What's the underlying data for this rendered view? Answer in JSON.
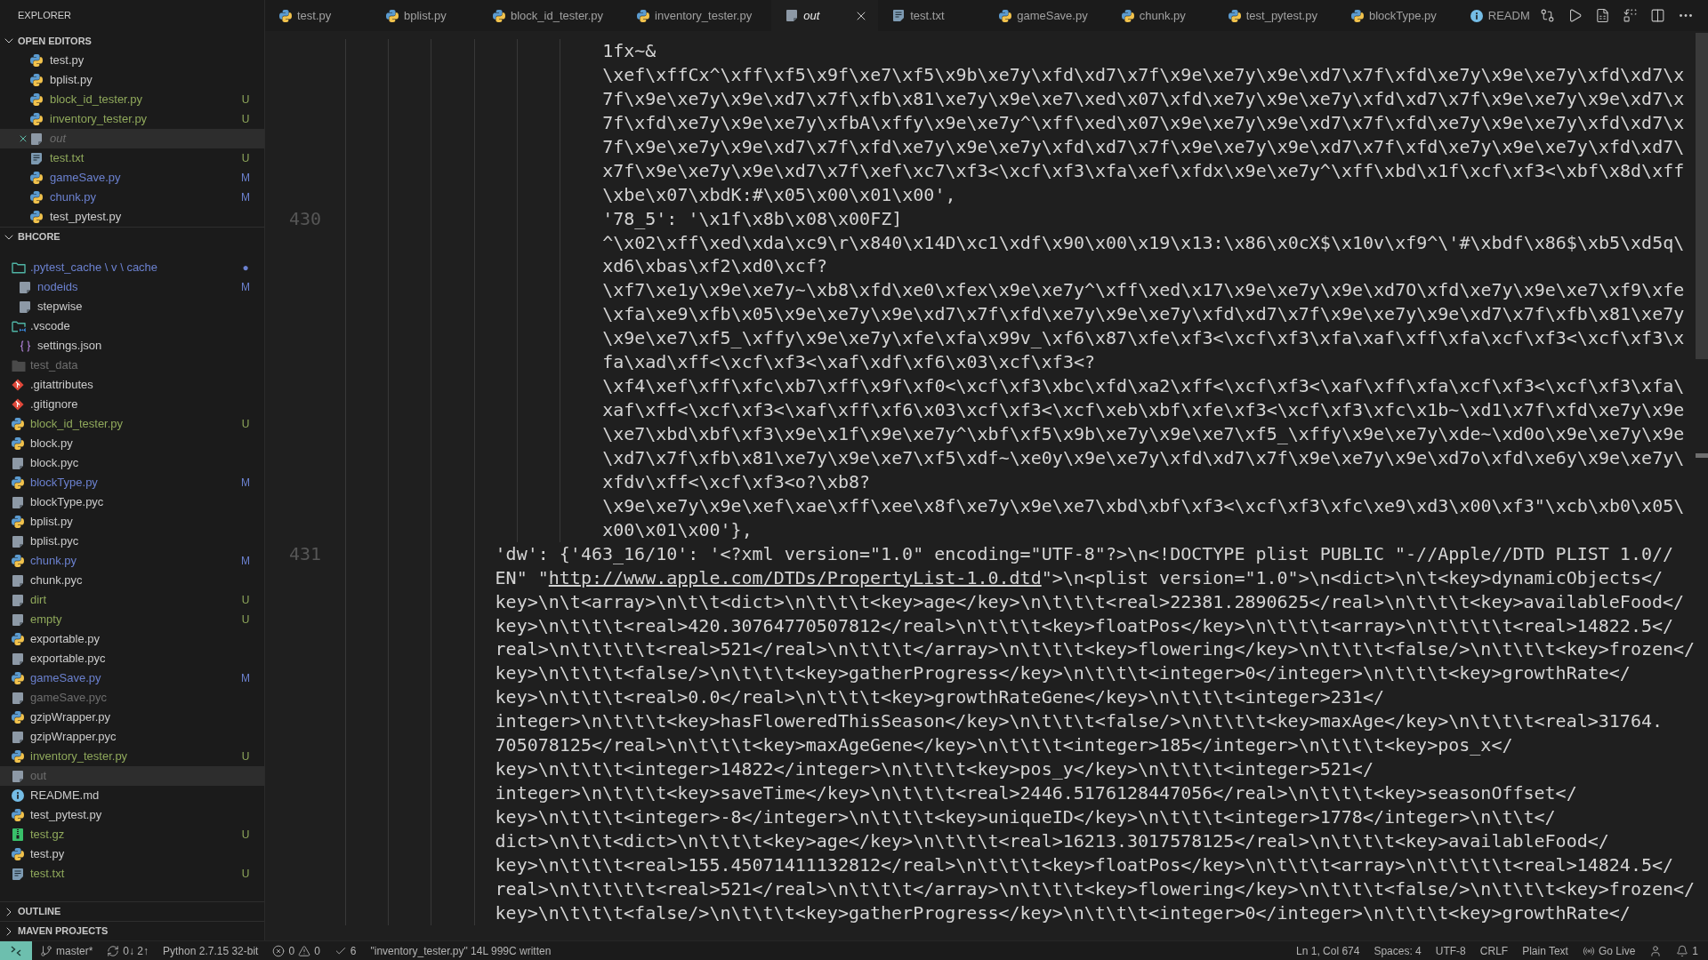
{
  "sidebar": {
    "title": "EXPLORER",
    "open_editors": {
      "title": "OPEN EDITORS",
      "expanded": true,
      "items": [
        {
          "name": "test.py",
          "kind": "python",
          "color": "#cccccc",
          "selected": false,
          "preview": false
        },
        {
          "name": "bplist.py",
          "kind": "python",
          "color": "#cccccc",
          "selected": false,
          "preview": false
        },
        {
          "name": "block_id_tester.py",
          "kind": "python",
          "color": "#8fa85b",
          "badge": "U",
          "selected": false,
          "preview": false
        },
        {
          "name": "inventory_tester.py",
          "kind": "python",
          "color": "#8fa85b",
          "badge": "U",
          "selected": false,
          "preview": false
        },
        {
          "name": "out",
          "kind": "file",
          "color": "#6e6e6e",
          "selected": true,
          "preview": true
        },
        {
          "name": "test.txt",
          "kind": "text",
          "color": "#8fa85b",
          "badge": "U",
          "selected": false,
          "preview": false
        },
        {
          "name": "gameSave.py",
          "kind": "python",
          "color": "#6b81cf",
          "badge": "M",
          "selected": false,
          "preview": false
        },
        {
          "name": "chunk.py",
          "kind": "python",
          "color": "#6b81cf",
          "badge": "M",
          "selected": false,
          "preview": false
        },
        {
          "name": "test_pytest.py",
          "kind": "python",
          "color": "#cccccc",
          "selected": false,
          "preview": false
        }
      ]
    },
    "folder": {
      "title": "BHCORE",
      "expanded": true,
      "items": [
        {
          "name": ".pytest_cache \\ v \\ cache",
          "kind": "folder",
          "expanded": true,
          "color": "#6b81cf",
          "badge": "●",
          "selected": false,
          "children": [
            {
              "name": "nodeids",
              "kind": "file",
              "color": "#6b81cf",
              "badge": "M",
              "selected": false
            },
            {
              "name": "stepwise",
              "kind": "file",
              "color": "#cccccc",
              "selected": false
            }
          ]
        },
        {
          "name": ".vscode",
          "kind": "vscode-folder",
          "expanded": true,
          "color": "#cccccc",
          "selected": false,
          "children": [
            {
              "name": "settings.json",
              "kind": "json",
              "color": "#cccccc",
              "selected": false
            }
          ]
        },
        {
          "name": "test_data",
          "kind": "folder",
          "expanded": false,
          "color": "#6e6e6e",
          "selected": false
        },
        {
          "name": ".gitattributes",
          "kind": "git",
          "color": "#cccccc",
          "selected": false
        },
        {
          "name": ".gitignore",
          "kind": "git",
          "color": "#cccccc",
          "selected": false
        },
        {
          "name": "block_id_tester.py",
          "kind": "python",
          "color": "#8fa85b",
          "badge": "U",
          "selected": false
        },
        {
          "name": "block.py",
          "kind": "python",
          "color": "#cccccc",
          "selected": false
        },
        {
          "name": "block.pyc",
          "kind": "file",
          "color": "#cccccc",
          "selected": false
        },
        {
          "name": "blockType.py",
          "kind": "python",
          "color": "#6b81cf",
          "badge": "M",
          "selected": false
        },
        {
          "name": "blockType.pyc",
          "kind": "file",
          "color": "#cccccc",
          "selected": false
        },
        {
          "name": "bplist.py",
          "kind": "python",
          "color": "#cccccc",
          "selected": false
        },
        {
          "name": "bplist.pyc",
          "kind": "file",
          "color": "#cccccc",
          "selected": false
        },
        {
          "name": "chunk.py",
          "kind": "python",
          "color": "#6b81cf",
          "badge": "M",
          "selected": false
        },
        {
          "name": "chunk.pyc",
          "kind": "file",
          "color": "#cccccc",
          "selected": false
        },
        {
          "name": "dirt",
          "kind": "file",
          "color": "#8fa85b",
          "badge": "U",
          "selected": false
        },
        {
          "name": "empty",
          "kind": "file",
          "color": "#8fa85b",
          "badge": "U",
          "selected": false
        },
        {
          "name": "exportable.py",
          "kind": "python",
          "color": "#cccccc",
          "selected": false
        },
        {
          "name": "exportable.pyc",
          "kind": "file",
          "color": "#cccccc",
          "selected": false
        },
        {
          "name": "gameSave.py",
          "kind": "python",
          "color": "#6b81cf",
          "badge": "M",
          "selected": false
        },
        {
          "name": "gameSave.pyc",
          "kind": "file",
          "color": "#6e6e6e",
          "selected": false
        },
        {
          "name": "gzipWrapper.py",
          "kind": "python",
          "color": "#cccccc",
          "selected": false
        },
        {
          "name": "gzipWrapper.pyc",
          "kind": "file",
          "color": "#cccccc",
          "selected": false
        },
        {
          "name": "inventory_tester.py",
          "kind": "python",
          "color": "#8fa85b",
          "badge": "U",
          "selected": false
        },
        {
          "name": "out",
          "kind": "file",
          "color": "#6e6e6e",
          "selected": true
        },
        {
          "name": "README.md",
          "kind": "info",
          "color": "#cccccc",
          "selected": false
        },
        {
          "name": "test_pytest.py",
          "kind": "python",
          "color": "#cccccc",
          "selected": false
        },
        {
          "name": "test.gz",
          "kind": "archive",
          "color": "#8fa85b",
          "badge": "U",
          "selected": false
        },
        {
          "name": "test.py",
          "kind": "python",
          "color": "#cccccc",
          "selected": false
        },
        {
          "name": "test.txt",
          "kind": "text",
          "color": "#8fa85b",
          "badge": "U",
          "selected": false
        }
      ]
    },
    "sections": [
      {
        "title": "OUTLINE",
        "expanded": false
      },
      {
        "title": "MAVEN PROJECTS",
        "expanded": false
      }
    ]
  },
  "tabs": [
    {
      "label": "test.py",
      "kind": "python",
      "selected": false,
      "preview": false
    },
    {
      "label": "bplist.py",
      "kind": "python",
      "selected": false,
      "preview": false
    },
    {
      "label": "block_id_tester.py",
      "kind": "python",
      "selected": false,
      "preview": false
    },
    {
      "label": "inventory_tester.py",
      "kind": "python",
      "selected": false,
      "preview": false
    },
    {
      "label": "out",
      "kind": "file",
      "selected": true,
      "preview": true
    },
    {
      "label": "test.txt",
      "kind": "text",
      "selected": false,
      "preview": false
    },
    {
      "label": "gameSave.py",
      "kind": "python",
      "selected": false,
      "preview": false
    },
    {
      "label": "chunk.py",
      "kind": "python",
      "selected": false,
      "preview": false
    },
    {
      "label": "test_pytest.py",
      "kind": "python",
      "selected": false,
      "preview": false
    },
    {
      "label": "blockType.py",
      "kind": "python",
      "selected": false,
      "preview": false
    },
    {
      "label": "READM",
      "kind": "info",
      "selected": false,
      "preview": false
    }
  ],
  "editor": {
    "lines": [
      {
        "rows": [
          {
            "text": "1fx~&"
          },
          {
            "text": "\\xef\\xffCx^\\xff\\xf5\\x9f\\xe7\\xf5\\x9b\\xe7y\\xfd\\xd7\\x7f\\x9e\\xe7y\\x9e\\xd7\\x7f\\xfd\\xe7y\\x9e\\xe7y\\xfd\\xd7\\x"
          },
          {
            "text": "7f\\x9e\\xe7y\\x9e\\xd7\\x7f\\xfb\\x81\\xe7y\\x9e\\xe7\\xed\\x07\\xfd\\xe7y\\x9e\\xe7y\\xfd\\xd7\\x7f\\x9e\\xe7y\\x9e\\xd7\\x"
          },
          {
            "text": "7f\\xfd\\xe7y\\x9e\\xe7y\\xfbA\\xffy\\x9e\\xe7y^\\xff\\xed\\x07\\x9e\\xe7y\\x9e\\xd7\\x7f\\xfd\\xe7y\\x9e\\xe7y\\xfd\\xd7\\x"
          },
          {
            "text": "7f\\x9e\\xe7y\\x9e\\xd7\\x7f\\xfd\\xe7y\\x9e\\xe7y\\xfd\\xd7\\x7f\\x9e\\xe7y\\x9e\\xd7\\x7f\\xfd\\xe7y\\x9e\\xe7y\\xfd\\xd7\\"
          },
          {
            "text": "x7f\\x9e\\xe7y\\x9e\\xd7\\x7f\\xef\\xc7\\xf3<\\xcf\\xf3\\xfa\\xef\\xfdx\\x9e\\xe7y^\\xff\\xbd\\x1f\\xcf\\xf3<\\xbf\\x8d\\xff"
          },
          {
            "text": "\\xbe\\x07\\xbdK:#\\x05\\x00\\x01\\x00',"
          }
        ]
      },
      {
        "number": "430",
        "rows": [
          {
            "text": "'78_5': '\\x1f\\x8b\\x08\\x00FZ]"
          },
          {
            "text": "^\\x02\\xff\\xed\\xda\\xc9\\r\\x840\\x14D\\xc1\\xdf\\x90\\x00\\x19\\x13:\\x86\\x0cX$\\x10v\\xf9^\\'#\\xbdf\\x86$\\xb5\\xd5q\\"
          },
          {
            "text": "xd6\\xbas\\xf2\\xd0\\xcf?"
          },
          {
            "text": "\\xf7\\xe1y\\x9e\\xe7y~\\xb8\\xfd\\xe0\\xfex\\x9e\\xe7y^\\xff\\xed\\x17\\x9e\\xe7y\\x9e\\xd7O\\xfd\\xe7y\\x9e\\xe7\\xf9\\xfe"
          },
          {
            "text": "\\xfa\\xe9\\xfb\\x05\\x9e\\xe7y\\x9e\\xd7\\x7f\\xfd\\xe7y\\x9e\\xe7y\\xfd\\xd7\\x7f\\x9e\\xe7y\\x9e\\xd7\\x7f\\xfb\\x81\\xe7y"
          },
          {
            "text": "\\x9e\\xe7\\xf5_\\xffy\\x9e\\xe7y\\xfe\\xfa\\x99v_\\xf6\\x87\\xfe\\xf3<\\xcf\\xf3\\xfa\\xaf\\xff\\xfa\\xcf\\xf3<\\xcf\\xf3\\x"
          },
          {
            "text": "fa\\xad\\xff<\\xcf\\xf3<\\xaf\\xdf\\xf6\\x03\\xcf\\xf3<?"
          },
          {
            "text": "\\xf4\\xef\\xff\\xfc\\xb7\\xff\\x9f\\xf0<\\xcf\\xf3\\xbc\\xfd\\xa2\\xff<\\xcf\\xf3<\\xaf\\xff\\xfa\\xcf\\xf3<\\xcf\\xf3\\xfa\\"
          },
          {
            "text": "xaf\\xff<\\xcf\\xf3<\\xaf\\xff\\xf6\\x03\\xcf\\xf3<\\xcf\\xeb\\xbf\\xfe\\xf3<\\xcf\\xf3\\xfc\\x1b~\\xd1\\x7f\\xfd\\xe7y\\x9e"
          },
          {
            "text": "\\xe7\\xbd\\xbf\\xf3\\x9e\\x1f\\x9e\\xe7y^\\xbf\\xf5\\x9b\\xe7y\\x9e\\xe7\\xf5_\\xffy\\x9e\\xe7y\\xde~\\xd0o\\x9e\\xe7y\\x9e"
          },
          {
            "text": "\\xd7\\x7f\\xfb\\x81\\xe7y\\x9e\\xe7\\xf5\\xdf~\\xe0y\\x9e\\xe7y\\xfd\\xd7\\x7f\\x9e\\xe7y\\x9e\\xd7o\\xfd\\xe6y\\x9e\\xe7y\\"
          },
          {
            "text": "xfdv\\xff<\\xcf\\xf3<o?\\xb8?"
          },
          {
            "text": "\\x9e\\xe7y\\x9e\\xef\\xae\\xff\\xee\\x8f\\xe7y\\x9e\\xe7\\xbd\\xbf\\xf3<\\xcf\\xf3\\xfc\\xe9\\xd3\\x00\\xf3\"\\xcb\\xb0\\x05\\"
          },
          {
            "text": "x00\\x01\\x00'},"
          }
        ]
      },
      {
        "number": "431",
        "rows": [
          {
            "text": "'dw': {'463_16/10': '<?xml version=\"1.0\" encoding=\"UTF-8\"?>\\n<!DOCTYPE plist PUBLIC \"-//Apple//DTD PLIST 1.0//"
          },
          {
            "text": "EN\" \"",
            "link": "http://www.apple.com/DTDs/PropertyList-1.0.dtd",
            "after": "\">\\n<plist version=\"1.0\">\\n<dict>\\n\\t<key>dynamicObjects</"
          },
          {
            "text": "key>\\n\\t<array>\\n\\t\\t<dict>\\n\\t\\t\\t<key>age</key>\\n\\t\\t\\t<real>22381.2890625</real>\\n\\t\\t\\t<key>availableFood</"
          },
          {
            "text": "key>\\n\\t\\t\\t<real>420.30764770507812</real>\\n\\t\\t\\t<key>floatPos</key>\\n\\t\\t\\t<array>\\n\\t\\t\\t\\t<real>14822.5</"
          },
          {
            "text": "real>\\n\\t\\t\\t\\t<real>521</real>\\n\\t\\t\\t</array>\\n\\t\\t\\t<key>flowering</key>\\n\\t\\t\\t<false/>\\n\\t\\t\\t<key>frozen</"
          },
          {
            "text": "key>\\n\\t\\t\\t<false/>\\n\\t\\t\\t<key>gatherProgress</key>\\n\\t\\t\\t<integer>0</integer>\\n\\t\\t\\t<key>growthRate</"
          },
          {
            "text": "key>\\n\\t\\t\\t<real>0.0</real>\\n\\t\\t\\t<key>growthRateGene</key>\\n\\t\\t\\t<integer>231</"
          },
          {
            "text": "integer>\\n\\t\\t\\t<key>hasFloweredThisSeason</key>\\n\\t\\t\\t<false/>\\n\\t\\t\\t<key>maxAge</key>\\n\\t\\t\\t<real>31764."
          },
          {
            "text": "705078125</real>\\n\\t\\t\\t<key>maxAgeGene</key>\\n\\t\\t\\t<integer>185</integer>\\n\\t\\t\\t<key>pos_x</"
          },
          {
            "text": "key>\\n\\t\\t\\t<integer>14822</integer>\\n\\t\\t\\t<key>pos_y</key>\\n\\t\\t\\t<integer>521</"
          },
          {
            "text": "integer>\\n\\t\\t\\t<key>saveTime</key>\\n\\t\\t\\t<real>2446.5176128447056</real>\\n\\t\\t\\t<key>seasonOffset</"
          },
          {
            "text": "key>\\n\\t\\t\\t<integer>-8</integer>\\n\\t\\t\\t<key>uniqueID</key>\\n\\t\\t\\t<integer>1778</integer>\\n\\t\\t</"
          },
          {
            "text": "dict>\\n\\t\\t<dict>\\n\\t\\t\\t<key>age</key>\\n\\t\\t\\t<real>16213.3017578125</real>\\n\\t\\t\\t<key>availableFood</"
          },
          {
            "text": "key>\\n\\t\\t\\t<real>155.45071411132812</real>\\n\\t\\t\\t<key>floatPos</key>\\n\\t\\t\\t<array>\\n\\t\\t\\t\\t<real>14824.5</"
          },
          {
            "text": "real>\\n\\t\\t\\t\\t<real>521</real>\\n\\t\\t\\t</array>\\n\\t\\t\\t<key>flowering</key>\\n\\t\\t\\t<false/>\\n\\t\\t\\t<key>frozen</"
          },
          {
            "text": "key>\\n\\t\\t\\t<false/>\\n\\t\\t\\t<key>gatherProgress</key>\\n\\t\\t\\t<integer>0</integer>\\n\\t\\t\\t<key>growthRate</"
          }
        ]
      }
    ]
  },
  "status_bar": {
    "left": [
      {
        "kind": "branch",
        "text": "master*"
      },
      {
        "kind": "sync",
        "text": "0↓ 2↑"
      },
      {
        "kind": "plain",
        "text": "Python 2.7.15 32-bit"
      },
      {
        "kind": "problems",
        "errors": "0",
        "warnings": "0"
      },
      {
        "kind": "check",
        "text": "6"
      },
      {
        "kind": "plain",
        "text": "\"inventory_tester.py\" 14L 999C written"
      }
    ],
    "right": [
      {
        "kind": "plain",
        "text": "Ln 1, Col 674"
      },
      {
        "kind": "plain",
        "text": "Spaces: 4"
      },
      {
        "kind": "plain",
        "text": "UTF-8"
      },
      {
        "kind": "plain",
        "text": "CRLF"
      },
      {
        "kind": "plain",
        "text": "Plain Text"
      },
      {
        "kind": "live",
        "text": "Go Live"
      },
      {
        "kind": "feedback"
      },
      {
        "kind": "bell",
        "text": "1"
      }
    ]
  }
}
